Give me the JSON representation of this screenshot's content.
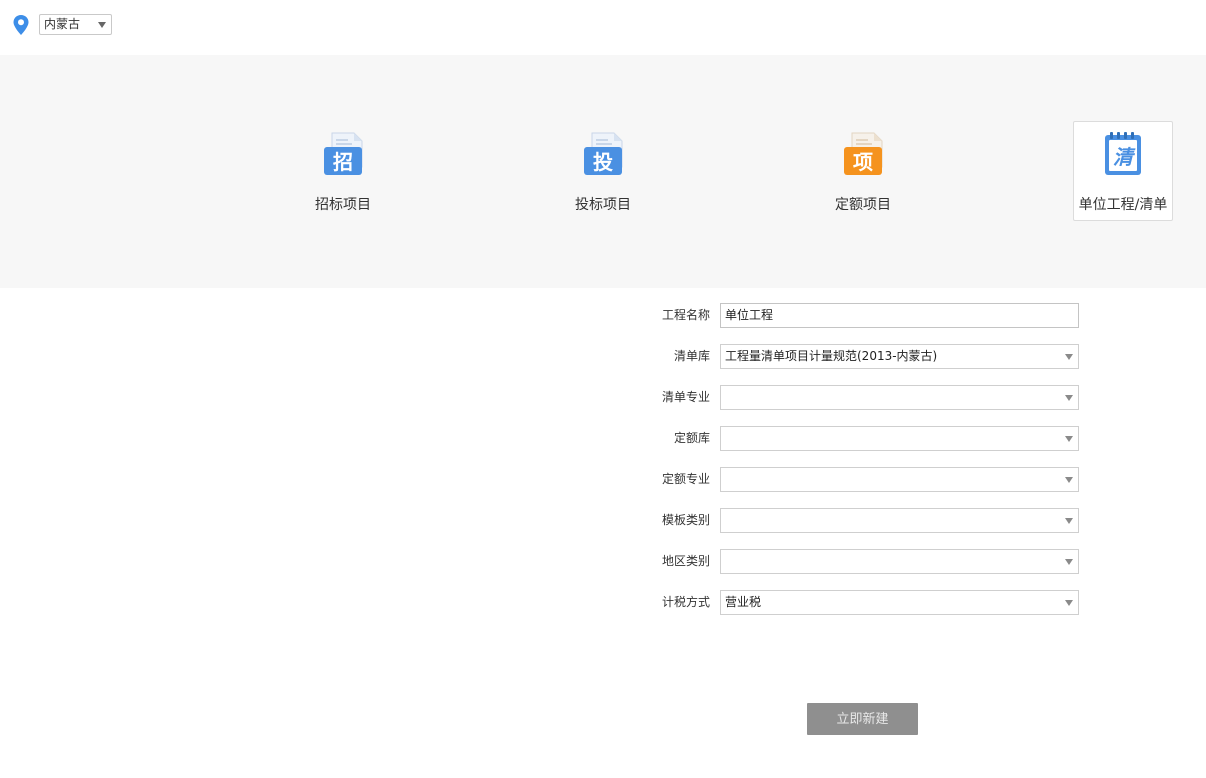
{
  "region": {
    "selected": "内蒙古"
  },
  "project_types": [
    {
      "label": "招标项目",
      "icon_char": "招",
      "icon": "document-zhao-icon",
      "color": "#4a90e2",
      "active": false
    },
    {
      "label": "投标项目",
      "icon_char": "投",
      "icon": "document-tou-icon",
      "color": "#4a90e2",
      "active": false
    },
    {
      "label": "定额项目",
      "icon_char": "项",
      "icon": "document-xiang-icon",
      "color": "#f5931e",
      "active": false
    },
    {
      "label": "单位工程/清单",
      "icon_char": "清",
      "icon": "notebook-qing-icon",
      "color": "#4a90e2",
      "active": true
    }
  ],
  "form": {
    "project_name": {
      "label": "工程名称",
      "value": "单位工程"
    },
    "bill_library": {
      "label": "清单库",
      "value": "工程量清单项目计量规范(2013-内蒙古)"
    },
    "bill_specialty": {
      "label": "清单专业",
      "value": ""
    },
    "quota_library": {
      "label": "定额库",
      "value": ""
    },
    "quota_specialty": {
      "label": "定额专业",
      "value": ""
    },
    "template_category": {
      "label": "模板类别",
      "value": ""
    },
    "region_category": {
      "label": "地区类别",
      "value": ""
    },
    "tax_method": {
      "label": "计税方式",
      "value": "营业税"
    }
  },
  "submit_label": "立即新建"
}
